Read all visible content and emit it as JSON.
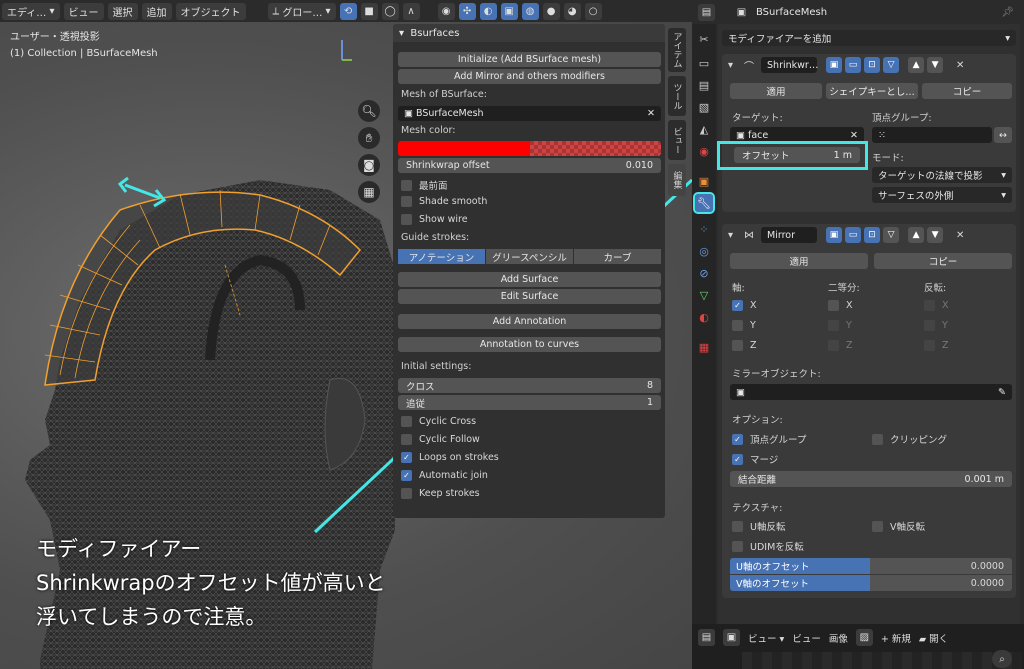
{
  "viewport": {
    "header": {
      "mode": "エディ…",
      "view": "ビュー",
      "select": "選択",
      "add": "追加",
      "object": "オブジェクト",
      "orientation": "グロー…"
    },
    "info_line1": "ユーザー・透視投影",
    "info_line2": "(1) Collection | BSurfaceMesh"
  },
  "bsurfaces": {
    "title": "Bsurfaces",
    "initialize": "Initialize (Add BSurface mesh)",
    "add_mirror": "Add Mirror and others modifiers",
    "mesh_label": "Mesh of BSurface:",
    "mesh_value": "BSurfaceMesh",
    "color_label": "Mesh color:",
    "shrinkwrap_label": "Shrinkwrap offset",
    "shrinkwrap_value": "0.010",
    "in_front": "最前面",
    "shade_smooth": "Shade smooth",
    "show_wire": "Show wire",
    "guide_label": "Guide strokes:",
    "guide_tabs": [
      "アノテーション",
      "グリースペンシル",
      "カーブ"
    ],
    "add_surface": "Add Surface",
    "edit_surface": "Edit Surface",
    "add_annotation": "Add Annotation",
    "annotation_to_curves": "Annotation to curves",
    "initial_label": "Initial settings:",
    "cross_label": "クロス",
    "cross_value": "8",
    "follow_label": "追従",
    "follow_value": "1",
    "cyclic_cross": "Cyclic Cross",
    "cyclic_follow": "Cyclic Follow",
    "loops_on_strokes": "Loops on strokes",
    "automatic_join": "Automatic join",
    "keep_strokes": "Keep strokes"
  },
  "side_tabs": [
    "アイテム",
    "ツール",
    "ビュー",
    "編集"
  ],
  "properties": {
    "object_name": "BSurfaceMesh",
    "add_modifier": "モディファイアーを追加",
    "shrinkwrap": {
      "name": "Shrinkwr…",
      "apply": "適用",
      "shapekey": "シェイプキーとし…",
      "copy": "コピー",
      "target_label": "ターゲット:",
      "target_value": "face",
      "vgroup_label": "頂点グループ:",
      "offset_label": "オフセット",
      "offset_value": "1 m",
      "mode_label": "モード:",
      "mode_value": "ターゲットの法線で投影",
      "side_value": "サーフェスの外側"
    },
    "mirror": {
      "name": "Mirror",
      "apply": "適用",
      "copy": "コピー",
      "axis_label": "軸:",
      "bisect_label": "二等分:",
      "flip_label": "反転:",
      "x": "X",
      "y": "Y",
      "z": "Z",
      "mirror_object_label": "ミラーオブジェクト:",
      "options_label": "オプション:",
      "vertex_groups": "頂点グループ",
      "clipping": "クリッピング",
      "merge": "マージ",
      "merge_distance_label": "結合距離",
      "merge_distance_value": "0.001 m",
      "texture_label": "テクスチャ:",
      "flip_u": "U軸反転",
      "flip_v": "V軸反転",
      "flip_udim": "UDIMを反転",
      "u_offset_label": "U軸のオフセット",
      "u_offset_value": "0.0000",
      "v_offset_label": "V軸のオフセット",
      "v_offset_value": "0.0000"
    }
  },
  "bottom_bar": {
    "view": "ビュー",
    "view2": "ビュー",
    "image": "画像",
    "new": "新規",
    "open": "開く"
  },
  "annotation": {
    "line1": "モディファイアー",
    "line2": "Shrinkwrapのオフセット値が高いと",
    "line3": "浮いてしまうので注意。",
    "color": "#45e6e6"
  },
  "colors": {
    "accent": "#4772b3",
    "mesh_color": "#ff0000",
    "wire": "#f0a030"
  }
}
